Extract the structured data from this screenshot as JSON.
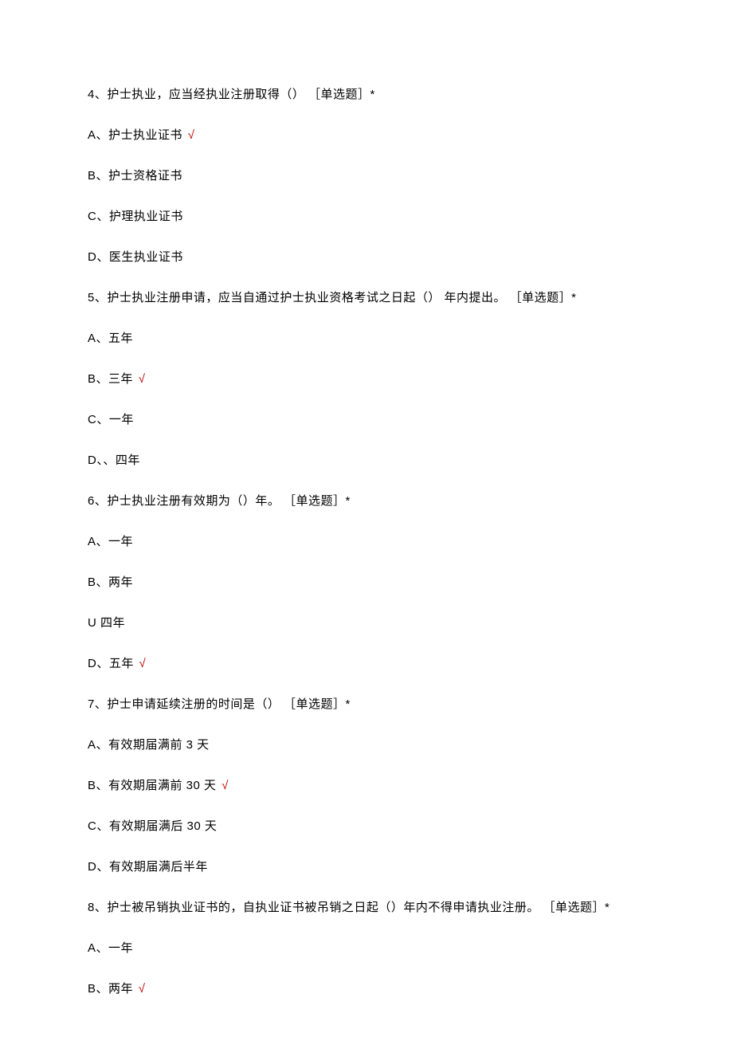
{
  "questions": [
    {
      "stem": "4、护士执业，应当经执业注册取得（） ［单选题］*",
      "options": [
        {
          "text": "A、护士执业证书",
          "correct": true
        },
        {
          "text": "B、护士资格证书",
          "correct": false
        },
        {
          "text": "C、护理执业证书",
          "correct": false
        },
        {
          "text": "D、医生执业证书",
          "correct": false
        }
      ]
    },
    {
      "stem": "5、护士执业注册申请，应当自通过护士执业资格考试之日起（） 年内提出。 ［单选题］*",
      "options": [
        {
          "text": "A、五年",
          "correct": false
        },
        {
          "text": "B、三年",
          "correct": true
        },
        {
          "text": "C、一年",
          "correct": false
        },
        {
          "text": "D、、四年",
          "correct": false
        }
      ]
    },
    {
      "stem": "6、护士执业注册有效期为（）年。 ［单选题］*",
      "options": [
        {
          "text": "A、一年",
          "correct": false
        },
        {
          "text": "B、两年",
          "correct": false
        },
        {
          "text": "U 四年",
          "correct": false
        },
        {
          "text": "D、五年",
          "correct": true
        }
      ]
    },
    {
      "stem": "7、护士申请延续注册的时间是（） ［单选题］*",
      "options": [
        {
          "text": "A、有效期届满前 3 天",
          "correct": false
        },
        {
          "text": "B、有效期届满前 30 天",
          "correct": true
        },
        {
          "text": "C、有效期届满后 30 天",
          "correct": false
        },
        {
          "text": "D、有效期届满后半年",
          "correct": false
        }
      ]
    },
    {
      "stem": "8、护士被吊销执业证书的，自执业证书被吊销之日起（）年内不得申请执业注册。 ［单选题］*",
      "options": [
        {
          "text": "A、一年",
          "correct": false
        },
        {
          "text": "B、两年",
          "correct": true
        }
      ]
    }
  ],
  "correct_mark": "√"
}
